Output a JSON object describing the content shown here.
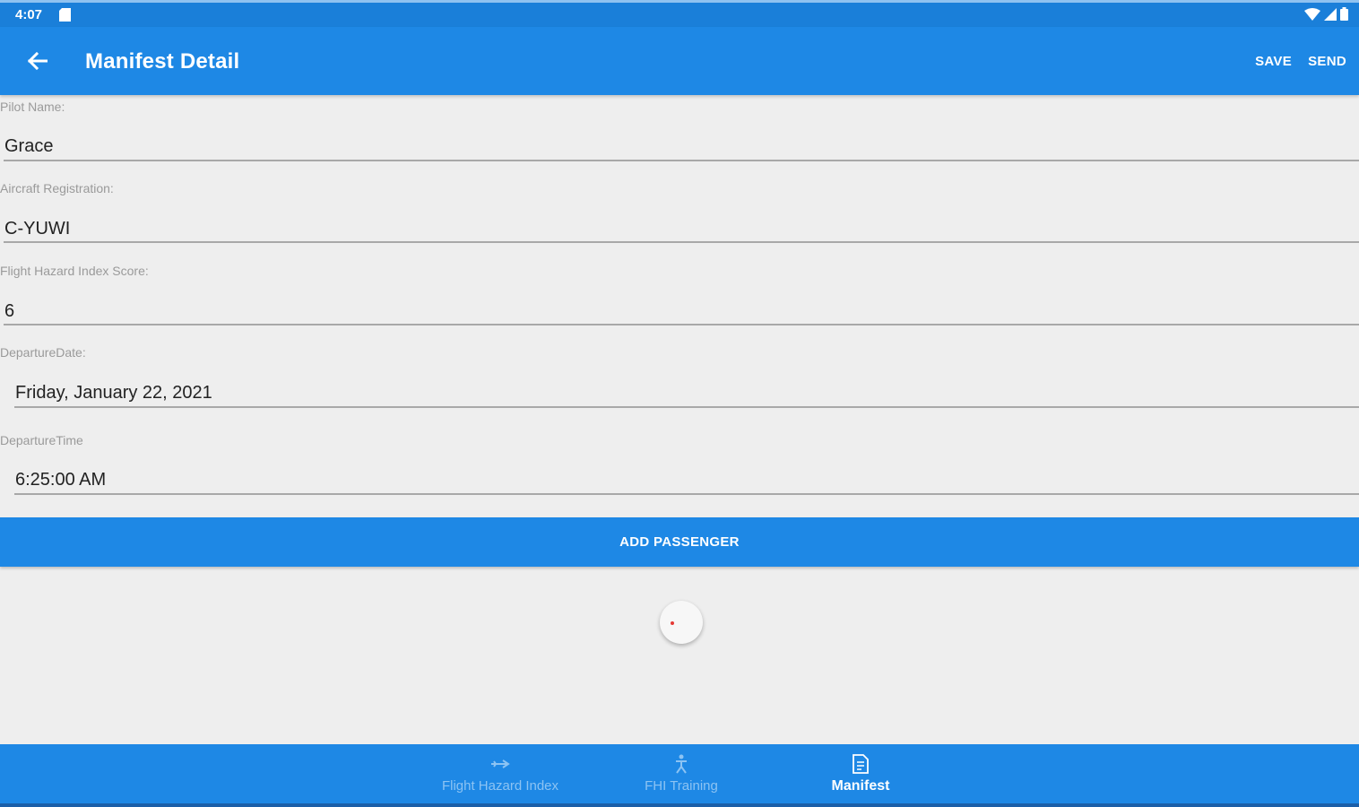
{
  "status_bar": {
    "time": "4:07"
  },
  "app_bar": {
    "title": "Manifest Detail",
    "save_label": "SAVE",
    "send_label": "SEND"
  },
  "form": {
    "pilot_name": {
      "label": "Pilot Name:",
      "value": "Grace"
    },
    "aircraft_registration": {
      "label": "Aircraft Registration:",
      "value": "C-YUWI"
    },
    "fhi_score": {
      "label": "Flight Hazard Index Score:",
      "value": "6"
    },
    "departure_date": {
      "label": "DepartureDate:",
      "value": "Friday, January 22, 2021"
    },
    "departure_time": {
      "label": "DepartureTime",
      "value": "6:25:00 AM"
    }
  },
  "add_passenger_label": "ADD PASSENGER",
  "bottom_nav": {
    "items": [
      {
        "label": "Flight Hazard Index",
        "icon": "plane-icon",
        "active": false
      },
      {
        "label": "FHI Training",
        "icon": "person-icon",
        "active": false
      },
      {
        "label": "Manifest",
        "icon": "document-icon",
        "active": true
      }
    ]
  },
  "colors": {
    "primary": "#1e88e5",
    "background": "#eeeeee",
    "accent": "#e53935"
  }
}
